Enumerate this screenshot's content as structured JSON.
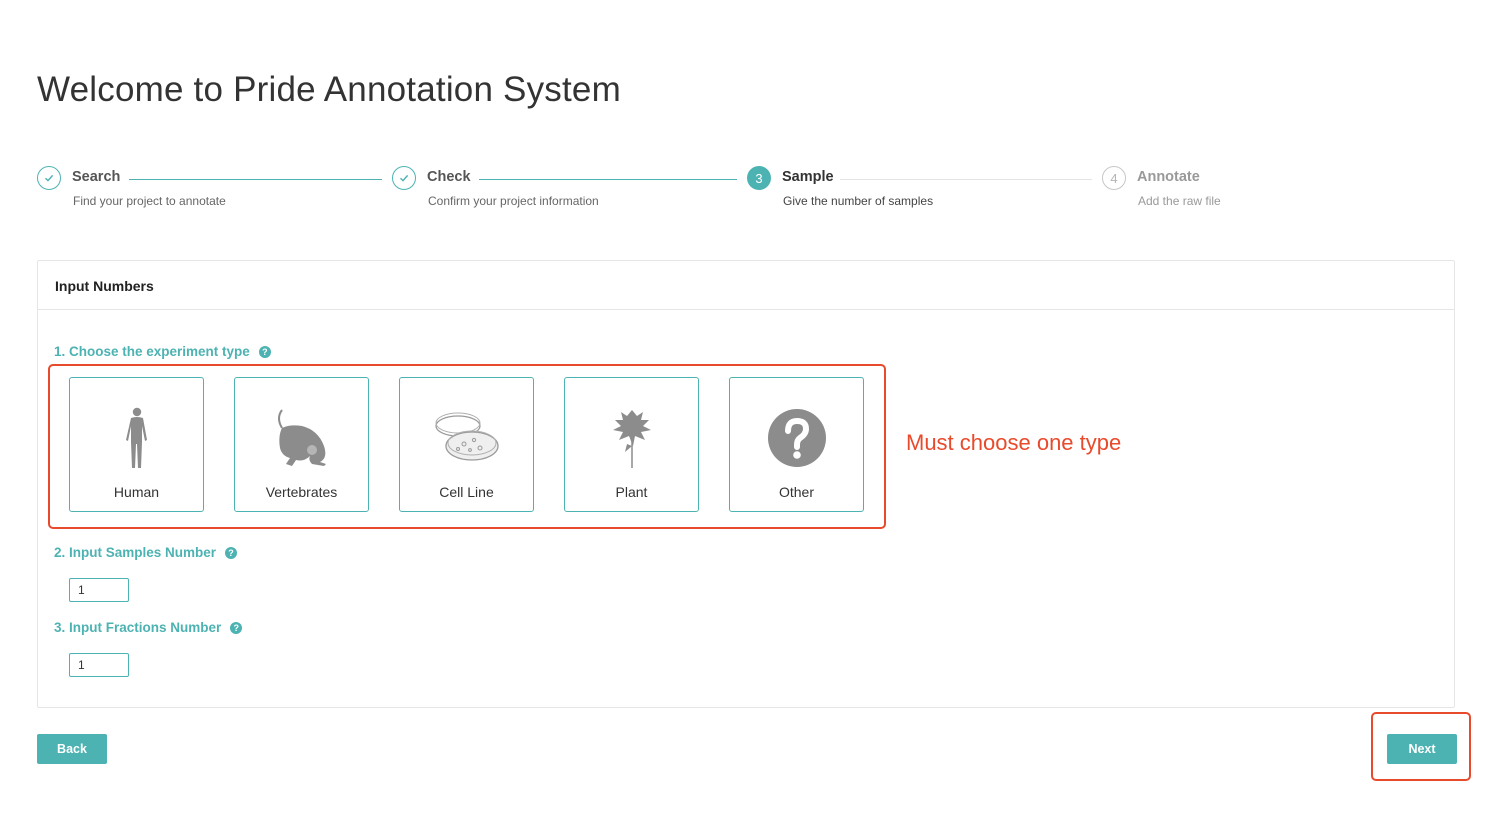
{
  "page": {
    "title": "Welcome to Pride Annotation System"
  },
  "steps": [
    {
      "number": "1",
      "title": "Search",
      "description": "Find your project to annotate",
      "status": "done"
    },
    {
      "number": "2",
      "title": "Check",
      "description": "Confirm your project information",
      "status": "done"
    },
    {
      "number": "3",
      "title": "Sample",
      "description": "Give the number of samples",
      "status": "active"
    },
    {
      "number": "4",
      "title": "Annotate",
      "description": "Add the raw file",
      "status": "pending"
    }
  ],
  "card": {
    "header": "Input Numbers",
    "question1": "1. Choose the experiment type",
    "question2": "2. Input Samples Number",
    "question3": "3. Input Fractions Number",
    "help_glyph": "?"
  },
  "experiment_types": [
    {
      "label": "Human",
      "icon": "human-icon"
    },
    {
      "label": "Vertebrates",
      "icon": "mouse-icon"
    },
    {
      "label": "Cell Line",
      "icon": "petri-dish-icon"
    },
    {
      "label": "Plant",
      "icon": "leaf-icon"
    },
    {
      "label": "Other",
      "icon": "question-icon"
    }
  ],
  "inputs": {
    "samples_value": "1",
    "fractions_value": "1"
  },
  "buttons": {
    "back": "Back",
    "next": "Next"
  },
  "annotation": {
    "note": "Must choose one type"
  },
  "colors": {
    "accent": "#4db3b2",
    "annotation": "#e84a2c",
    "icon_gray": "#8c8c8c"
  }
}
